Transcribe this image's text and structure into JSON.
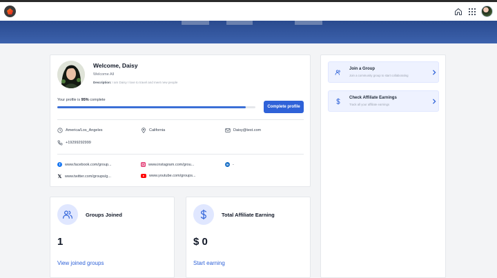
{
  "profile": {
    "welcome": "Welcome, Daisy",
    "subtitle": "Welcome All",
    "description_label": "Description:",
    "description_text": "I am Daisy I love to travel and meet new people",
    "progress_prefix": "Your profile is",
    "progress_value": "95%",
    "progress_suffix": "complete",
    "progress_fraction": 0.95,
    "complete_button": "Complete profile"
  },
  "info": {
    "timezone": "America/Los_Angeles",
    "state": "California",
    "email": "Daisy@test.com",
    "phone": "+19299292999"
  },
  "social": {
    "facebook": "www.facebook.com/group...",
    "instagram": "www.instagram.com/grou...",
    "linkedin": "-",
    "twitter": "www.twitter.com/groups/g...",
    "youtube": "www.youtube.com/groups..."
  },
  "stats": {
    "groups": {
      "title": "Groups Joined",
      "value": "1",
      "link": "View joined groups"
    },
    "earnings": {
      "title": "Total Affiliate Earning",
      "value": "$ 0",
      "link": "Start earning"
    }
  },
  "side": {
    "join": {
      "title": "Join a Group",
      "subtitle": "Join a community group to start collaborating"
    },
    "affiliate": {
      "title": "Check Affiliate Earnings",
      "subtitle": "Track all your affiliate earnings"
    }
  },
  "colors": {
    "accent": "#2f62d8",
    "banner": "#3c62ad",
    "facebook": "#1877f2",
    "instagram": "#e1306c",
    "linkedin": "#0a66c2",
    "youtube": "#ff0000"
  },
  "icons": [
    "app-logo-icon",
    "home-icon",
    "apps-grid-icon",
    "user-avatar",
    "clock-icon",
    "location-pin-icon",
    "mail-icon",
    "phone-icon",
    "facebook-icon",
    "instagram-icon",
    "linkedin-icon",
    "x-icon",
    "youtube-icon",
    "users-icon",
    "dollar-icon",
    "chevron-right-icon"
  ]
}
